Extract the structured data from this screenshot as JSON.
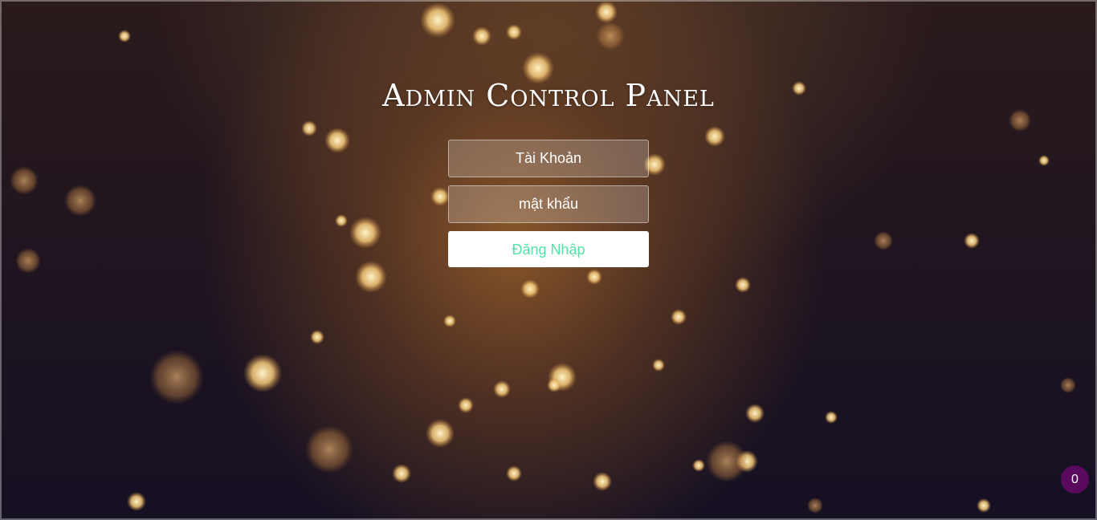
{
  "page": {
    "title": "Admin Control Panel"
  },
  "login_form": {
    "username_placeholder": "Tài Khoản",
    "password_placeholder": "mật khẩu",
    "submit_label": "Đăng Nhập"
  },
  "notification_badge": {
    "count": "0"
  },
  "colors": {
    "button_text": "#53e3a6",
    "badge_background": "#5a0a5e"
  }
}
